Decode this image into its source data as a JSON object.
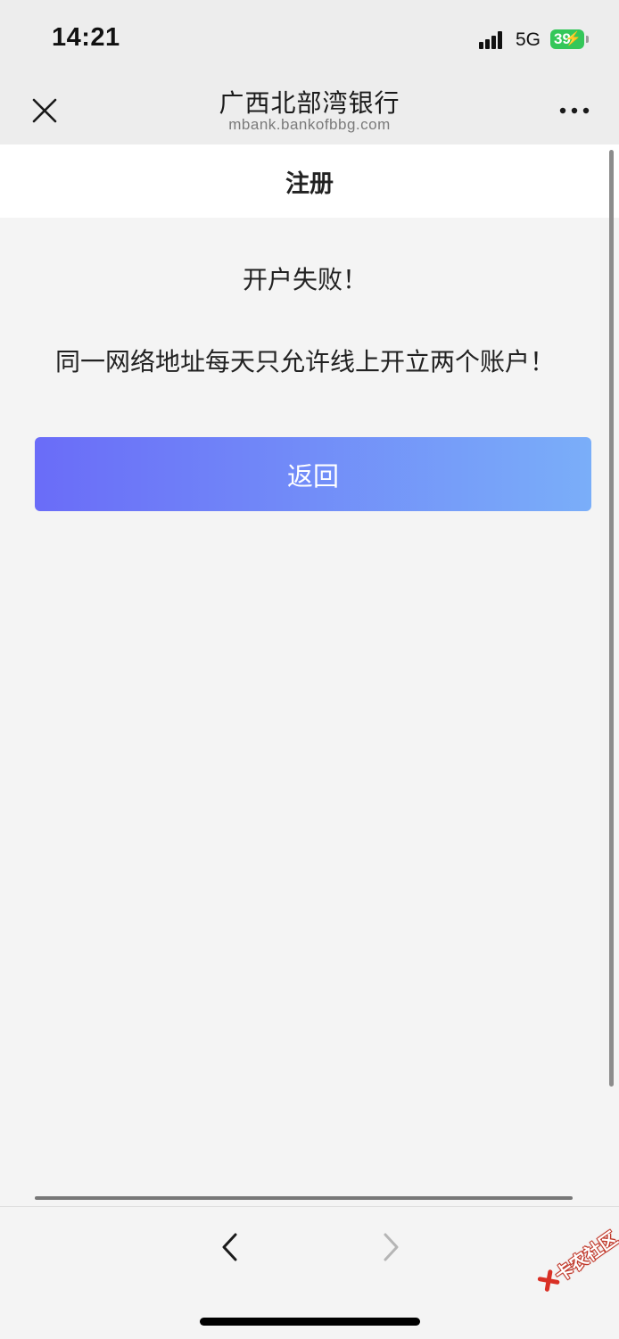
{
  "status_bar": {
    "time": "14:21",
    "network": "5G",
    "battery": "39",
    "battery_color": "#34c759"
  },
  "title_bar": {
    "close_icon": "close-icon",
    "title": "广西北部湾银行",
    "url": "mbank.bankofbbg.com",
    "more_icon": "more-dots-icon"
  },
  "page": {
    "title": "注册",
    "result_title": "开户失败！",
    "result_message": "同一网络地址每天只允许线上开立两个账户！",
    "back_button_label": "返回",
    "button_gradient": [
      "#6a6cf8",
      "#7aaef9"
    ]
  },
  "bottom_nav": {
    "back_icon": "chevron-left-icon",
    "forward_icon": "chevron-right-icon"
  },
  "watermark": {
    "text": "卡农社区"
  }
}
